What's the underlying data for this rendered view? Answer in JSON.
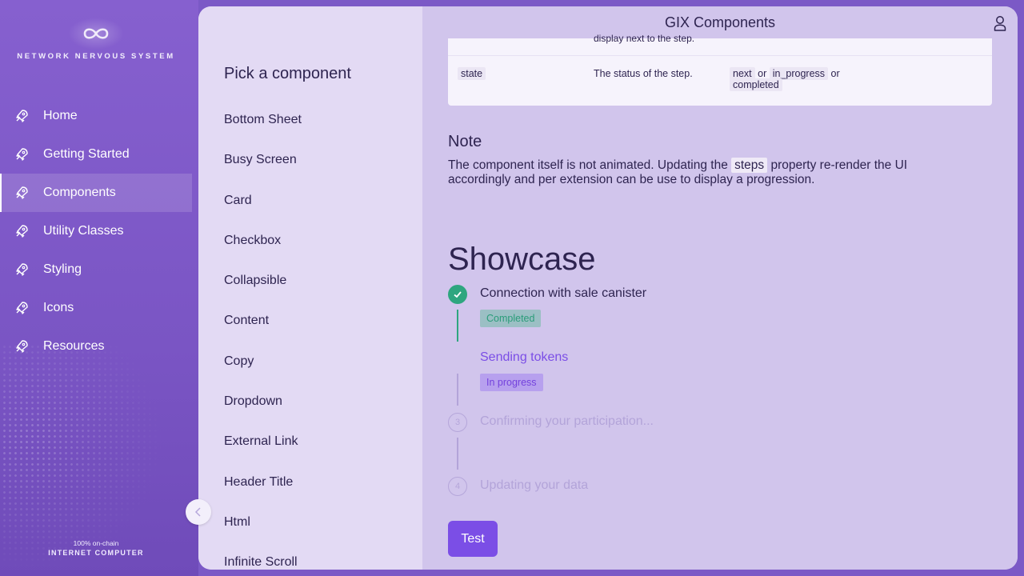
{
  "brand": {
    "logo_text": "NETWORK NERVOUS SYSTEM",
    "footer_line1": "100% on-chain",
    "footer_line2": "INTERNET COMPUTER"
  },
  "nav": {
    "items": [
      {
        "label": "Home",
        "icon": "rocket-icon"
      },
      {
        "label": "Getting Started",
        "icon": "rocket-icon"
      },
      {
        "label": "Components",
        "icon": "rocket-icon",
        "active": true
      },
      {
        "label": "Utility Classes",
        "icon": "rocket-icon"
      },
      {
        "label": "Styling",
        "icon": "rocket-icon"
      },
      {
        "label": "Icons",
        "icon": "rocket-icon"
      },
      {
        "label": "Resources",
        "icon": "rocket-icon"
      }
    ]
  },
  "header": {
    "title": "GIX Components"
  },
  "component_list": {
    "title": "Pick a component",
    "items": [
      "Bottom Sheet",
      "Busy Screen",
      "Card",
      "Checkbox",
      "Collapsible",
      "Content",
      "Copy",
      "Dropdown",
      "External Link",
      "Header Title",
      "Html",
      "Infinite Scroll"
    ]
  },
  "props_table": {
    "cut_text": "display next to the step.",
    "row": {
      "name": "state",
      "description": "The status of the step.",
      "values": [
        "next",
        "in_progress",
        "completed"
      ],
      "or_word": "or"
    }
  },
  "note": {
    "title": "Note",
    "text_before": "The component itself is not animated. Updating the ",
    "code": "steps",
    "text_after": " property re-render the UI accordingly and per extension can be use to display a progression."
  },
  "showcase": {
    "title": "Showcase",
    "steps": [
      {
        "label": "Connection with sale canister",
        "state": "completed",
        "tag": "Completed"
      },
      {
        "label": "Sending tokens",
        "state": "in_progress",
        "tag": "In progress"
      },
      {
        "label": "Confirming your participation...",
        "state": "next",
        "number": "3"
      },
      {
        "label": "Updating your data",
        "state": "next",
        "number": "4"
      }
    ],
    "button_label": "Test"
  },
  "colors": {
    "nav_bg": "#7b59c6",
    "accent": "#7b4ee6",
    "success": "#2ea67f"
  }
}
